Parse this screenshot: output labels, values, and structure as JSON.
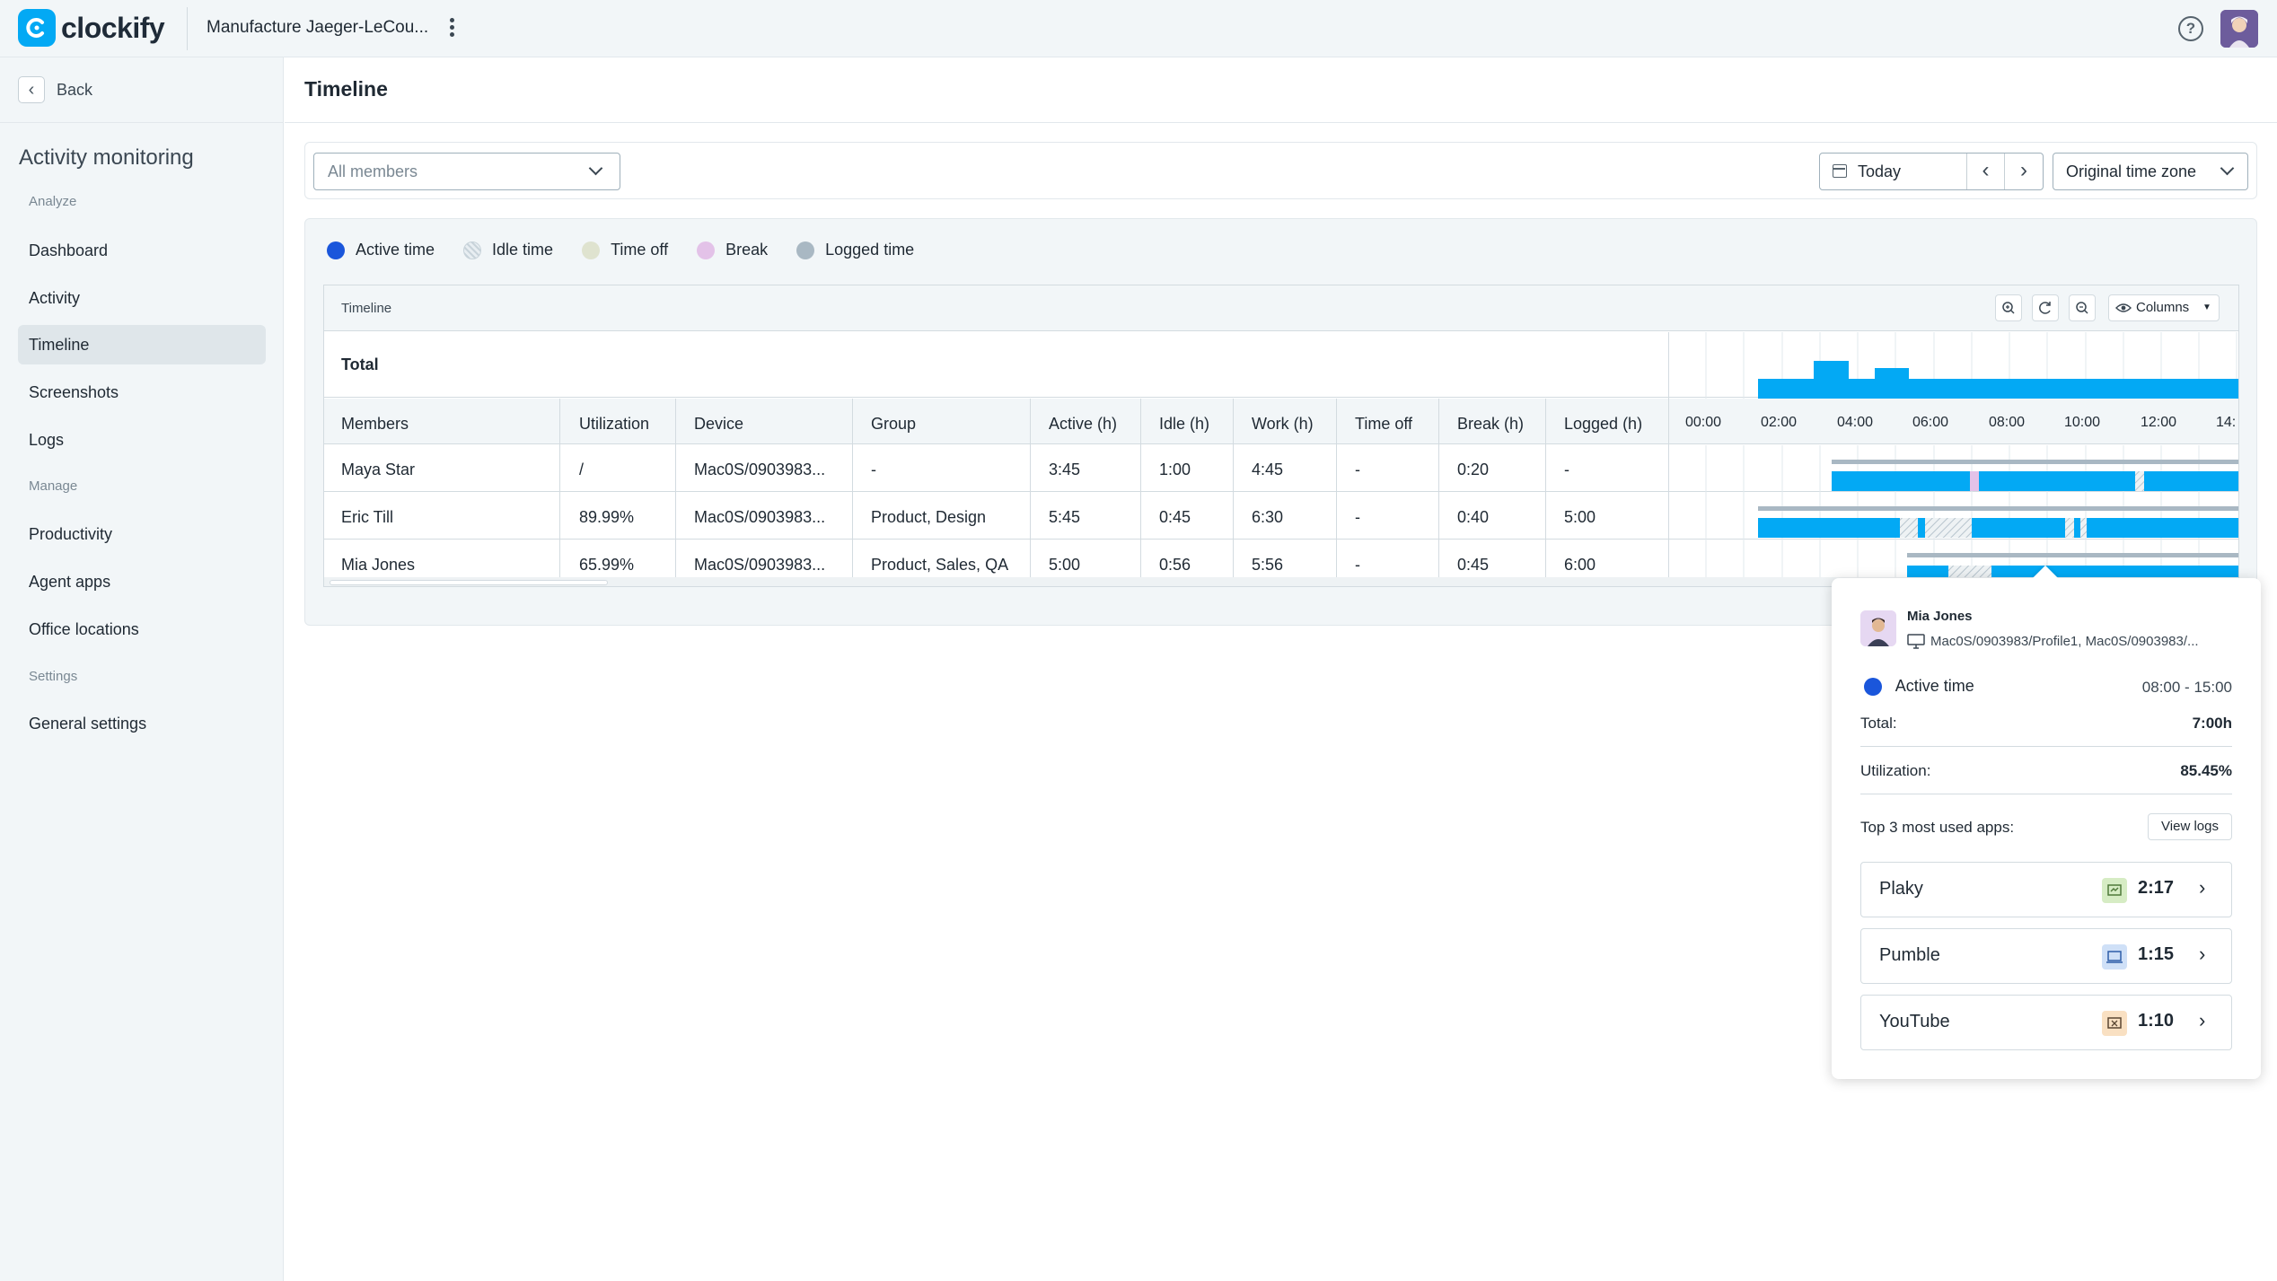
{
  "colors": {
    "active": "#03a9f4",
    "brand": "#03a9f4",
    "logged": "#a9b8c3",
    "idle_hatch": "#c8d3da",
    "break": "#e8c6ea",
    "legend_active": "#1a56db"
  },
  "app": {
    "brand_name": "clockify",
    "workspace": "Manufacture Jaeger-LeCou..."
  },
  "sidebar": {
    "back_label": "Back",
    "title": "Activity monitoring",
    "sections": [
      {
        "label": "Analyze",
        "items": [
          "Dashboard",
          "Activity",
          "Timeline",
          "Screenshots",
          "Logs"
        ]
      },
      {
        "label": "Manage",
        "items": [
          "Productivity",
          "Agent apps",
          "Office locations"
        ]
      },
      {
        "label": "Settings",
        "items": [
          "General settings"
        ]
      }
    ],
    "active_item": "Timeline"
  },
  "page": {
    "title": "Timeline"
  },
  "filters": {
    "members_placeholder": "All members",
    "date_label": "Today",
    "timezone_label": "Original time zone"
  },
  "legend": [
    {
      "label": "Active time",
      "color": "#1a56db"
    },
    {
      "label": "Idle time",
      "color": "#e8eef2"
    },
    {
      "label": "Time off",
      "color": "#dfe3cf"
    },
    {
      "label": "Break",
      "color": "#e3c2e8"
    },
    {
      "label": "Logged time",
      "color": "#a9b8c3"
    }
  ],
  "table": {
    "title": "Timeline",
    "columns_button": "Columns",
    "total_label": "Total",
    "headers": [
      "Members",
      "Utilization",
      "Device",
      "Group",
      "Active (h)",
      "Idle (h)",
      "Work (h)",
      "Time off",
      "Break (h)",
      "Logged (h)"
    ],
    "hour_labels": [
      "00:00",
      "02:00",
      "04:00",
      "06:00",
      "08:00",
      "10:00",
      "12:00",
      "14:"
    ],
    "rows": [
      {
        "member": "Maya Star",
        "utilization": "/",
        "device": "Mac0S/0903983...",
        "group": "-",
        "active": "3:45",
        "idle": "1:00",
        "work": "4:45",
        "time_off": "-",
        "break": "0:20",
        "logged": "-"
      },
      {
        "member": "Eric Till",
        "utilization": "89.99%",
        "device": "Mac0S/0903983...",
        "group": "Product, Design",
        "active": "5:45",
        "idle": "0:45",
        "work": "6:30",
        "time_off": "-",
        "break": "0:40",
        "logged": "5:00"
      },
      {
        "member": "Mia Jones",
        "utilization": "65.99%",
        "device": "Mac0S/0903983...",
        "group": "Product, Sales, QA",
        "active": "5:00",
        "idle": "0:56",
        "work": "5:56",
        "time_off": "-",
        "break": "0:45",
        "logged": "6:00"
      }
    ]
  },
  "popup": {
    "name": "Mia Jones",
    "device": "Mac0S/0903983/Profile1, Mac0S/0903983/...",
    "status_label": "Active time",
    "status_range": "08:00 - 15:00",
    "total_label": "Total:",
    "total_value": "7:00h",
    "utilization_label": "Utilization:",
    "utilization_value": "85.45%",
    "top_apps_label": "Top 3 most used apps:",
    "view_logs": "View logs",
    "apps": [
      {
        "name": "Plaky",
        "time": "2:17",
        "icon": "plaky-icon",
        "icon_color": "#d6ecc4"
      },
      {
        "name": "Pumble",
        "time": "1:15",
        "icon": "pumble-icon",
        "icon_color": "#cfe0f7"
      },
      {
        "name": "YouTube",
        "time": "1:10",
        "icon": "youtube-icon",
        "icon_color": "#f9e0c2"
      }
    ]
  }
}
